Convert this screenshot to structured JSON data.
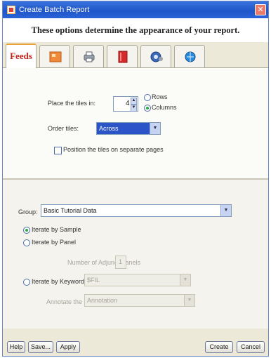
{
  "window": {
    "title": "Create Batch Report"
  },
  "header": {
    "text": "These options determine the appearance of your report."
  },
  "tabs": [
    {
      "label": "Feeds",
      "icon": "feeds-tab"
    },
    {
      "label": "",
      "icon": "layout-icon"
    },
    {
      "label": "",
      "icon": "printer-icon"
    },
    {
      "label": "",
      "icon": "book-icon"
    },
    {
      "label": "",
      "icon": "gear-icon"
    },
    {
      "label": "",
      "icon": "globe-icon"
    }
  ],
  "layout": {
    "place_label": "Place the tiles in:",
    "place_value": "4",
    "rows_label": "Rows",
    "columns_label": "Columns",
    "selected_orientation": "columns",
    "order_label": "Order tiles:",
    "order_value": "Across",
    "separate_pages_label": "Position the tiles on separate pages",
    "separate_pages_checked": false
  },
  "group": {
    "label": "Group:",
    "value": "Basic Tutorial Data",
    "options": {
      "by_sample": "Iterate by Sample",
      "by_panel": "Iterate by Panel",
      "by_keyword": "Iterate by Keyword"
    },
    "selected": "by_sample",
    "panels_label": "Number of Adjunct Panels",
    "panels_value": "1",
    "keyword_value": "$FIL",
    "annotate_label": "Annotate the",
    "annotate_value": "Annotation"
  },
  "footer": {
    "help": "Help",
    "save": "Save...",
    "apply": "Apply",
    "create": "Create",
    "cancel": "Cancel"
  },
  "colors": {
    "titlebar": "#2a63d8",
    "selection": "#2a54c8",
    "window": "#ece9d8"
  }
}
